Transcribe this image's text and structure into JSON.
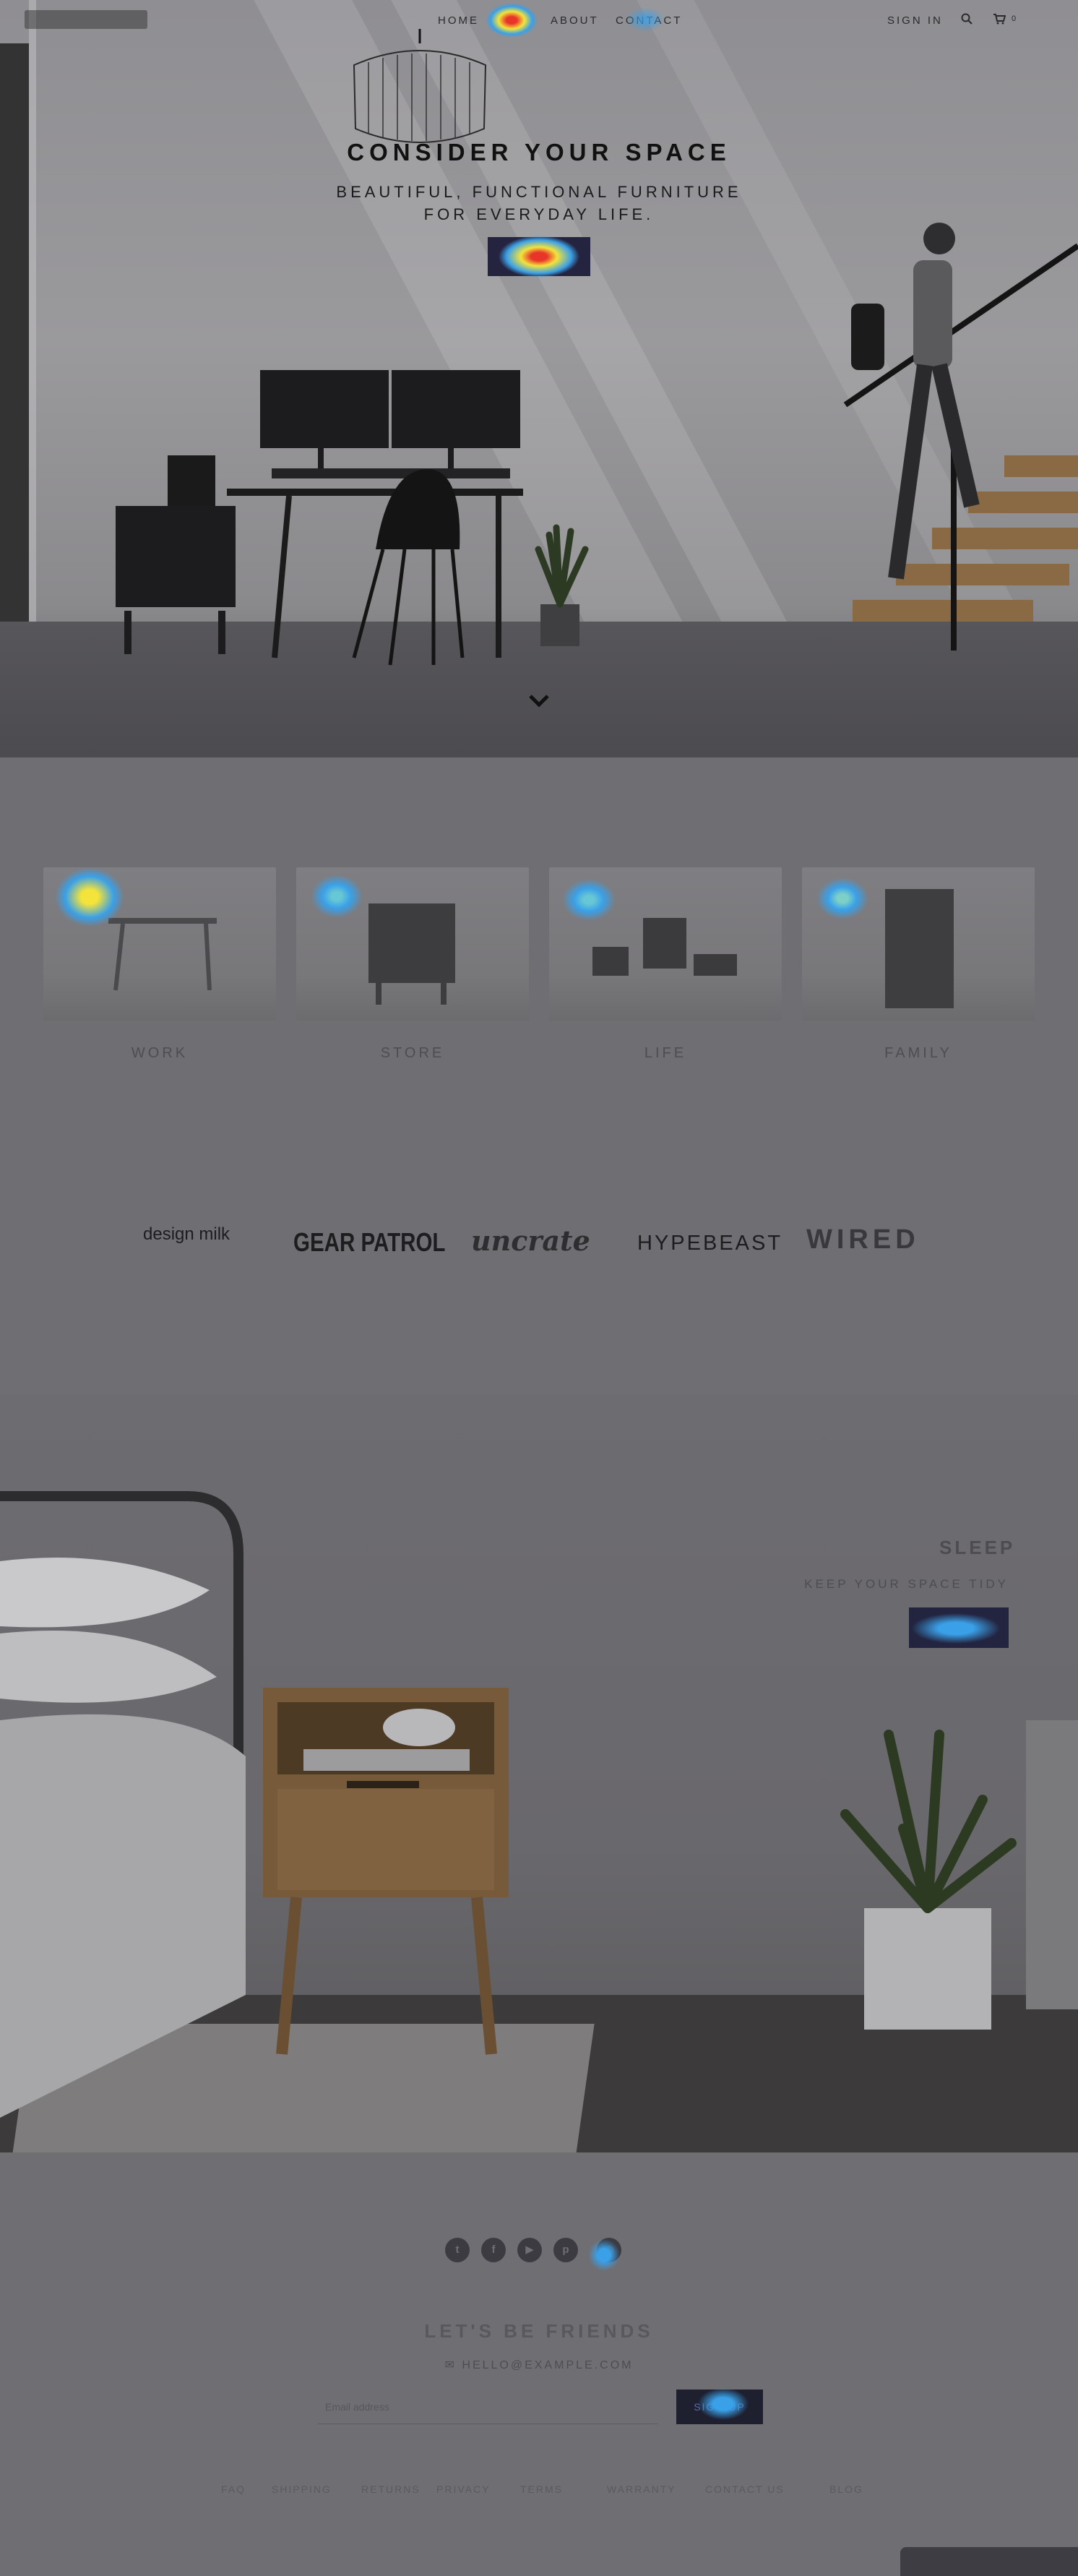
{
  "nav": {
    "links": [
      "HOME",
      "SHOP",
      "ABOUT",
      "CONTACT"
    ],
    "sign_in": "SIGN IN",
    "cart_count": "0"
  },
  "hero": {
    "title": "CONSIDER YOUR SPACE",
    "subtitle_line1": "BEAUTIFUL, FUNCTIONAL FURNITURE",
    "subtitle_line2": "FOR EVERYDAY LIFE.",
    "cta": "SHOP"
  },
  "categories": [
    {
      "label": "WORK"
    },
    {
      "label": "STORE"
    },
    {
      "label": "LIFE"
    },
    {
      "label": "FAMILY"
    }
  ],
  "press": {
    "logos": [
      "design milk",
      "GEAR PATROL",
      "uncrate",
      "HYPEBEAST",
      "WIRED"
    ]
  },
  "bedroom": {
    "heading": "SLEEP",
    "subtitle": "KEEP YOUR SPACE TIDY",
    "cta": "SHOP"
  },
  "footer": {
    "social_icons": [
      "twitter-icon",
      "facebook-icon",
      "youtube-icon",
      "pinterest-icon",
      "instagram-icon"
    ],
    "lets_be_friends": "LET'S BE FRIENDS",
    "mail_line": "HELLO@EXAMPLE.COM",
    "email_placeholder": "Email address",
    "signup_label": "SIGN UP",
    "links": [
      "FAQ",
      "SHIPPING",
      "RETURNS",
      "PRIVACY",
      "TERMS",
      "WARRANTY",
      "CONTACT US",
      "BLOG"
    ]
  },
  "colors": {
    "overlay": "#6f6e72",
    "cta_dark": "#252440",
    "heat_hot": "#e8352a",
    "heat_warm": "#f3e33a",
    "heat_cool": "#3aa0e8"
  }
}
